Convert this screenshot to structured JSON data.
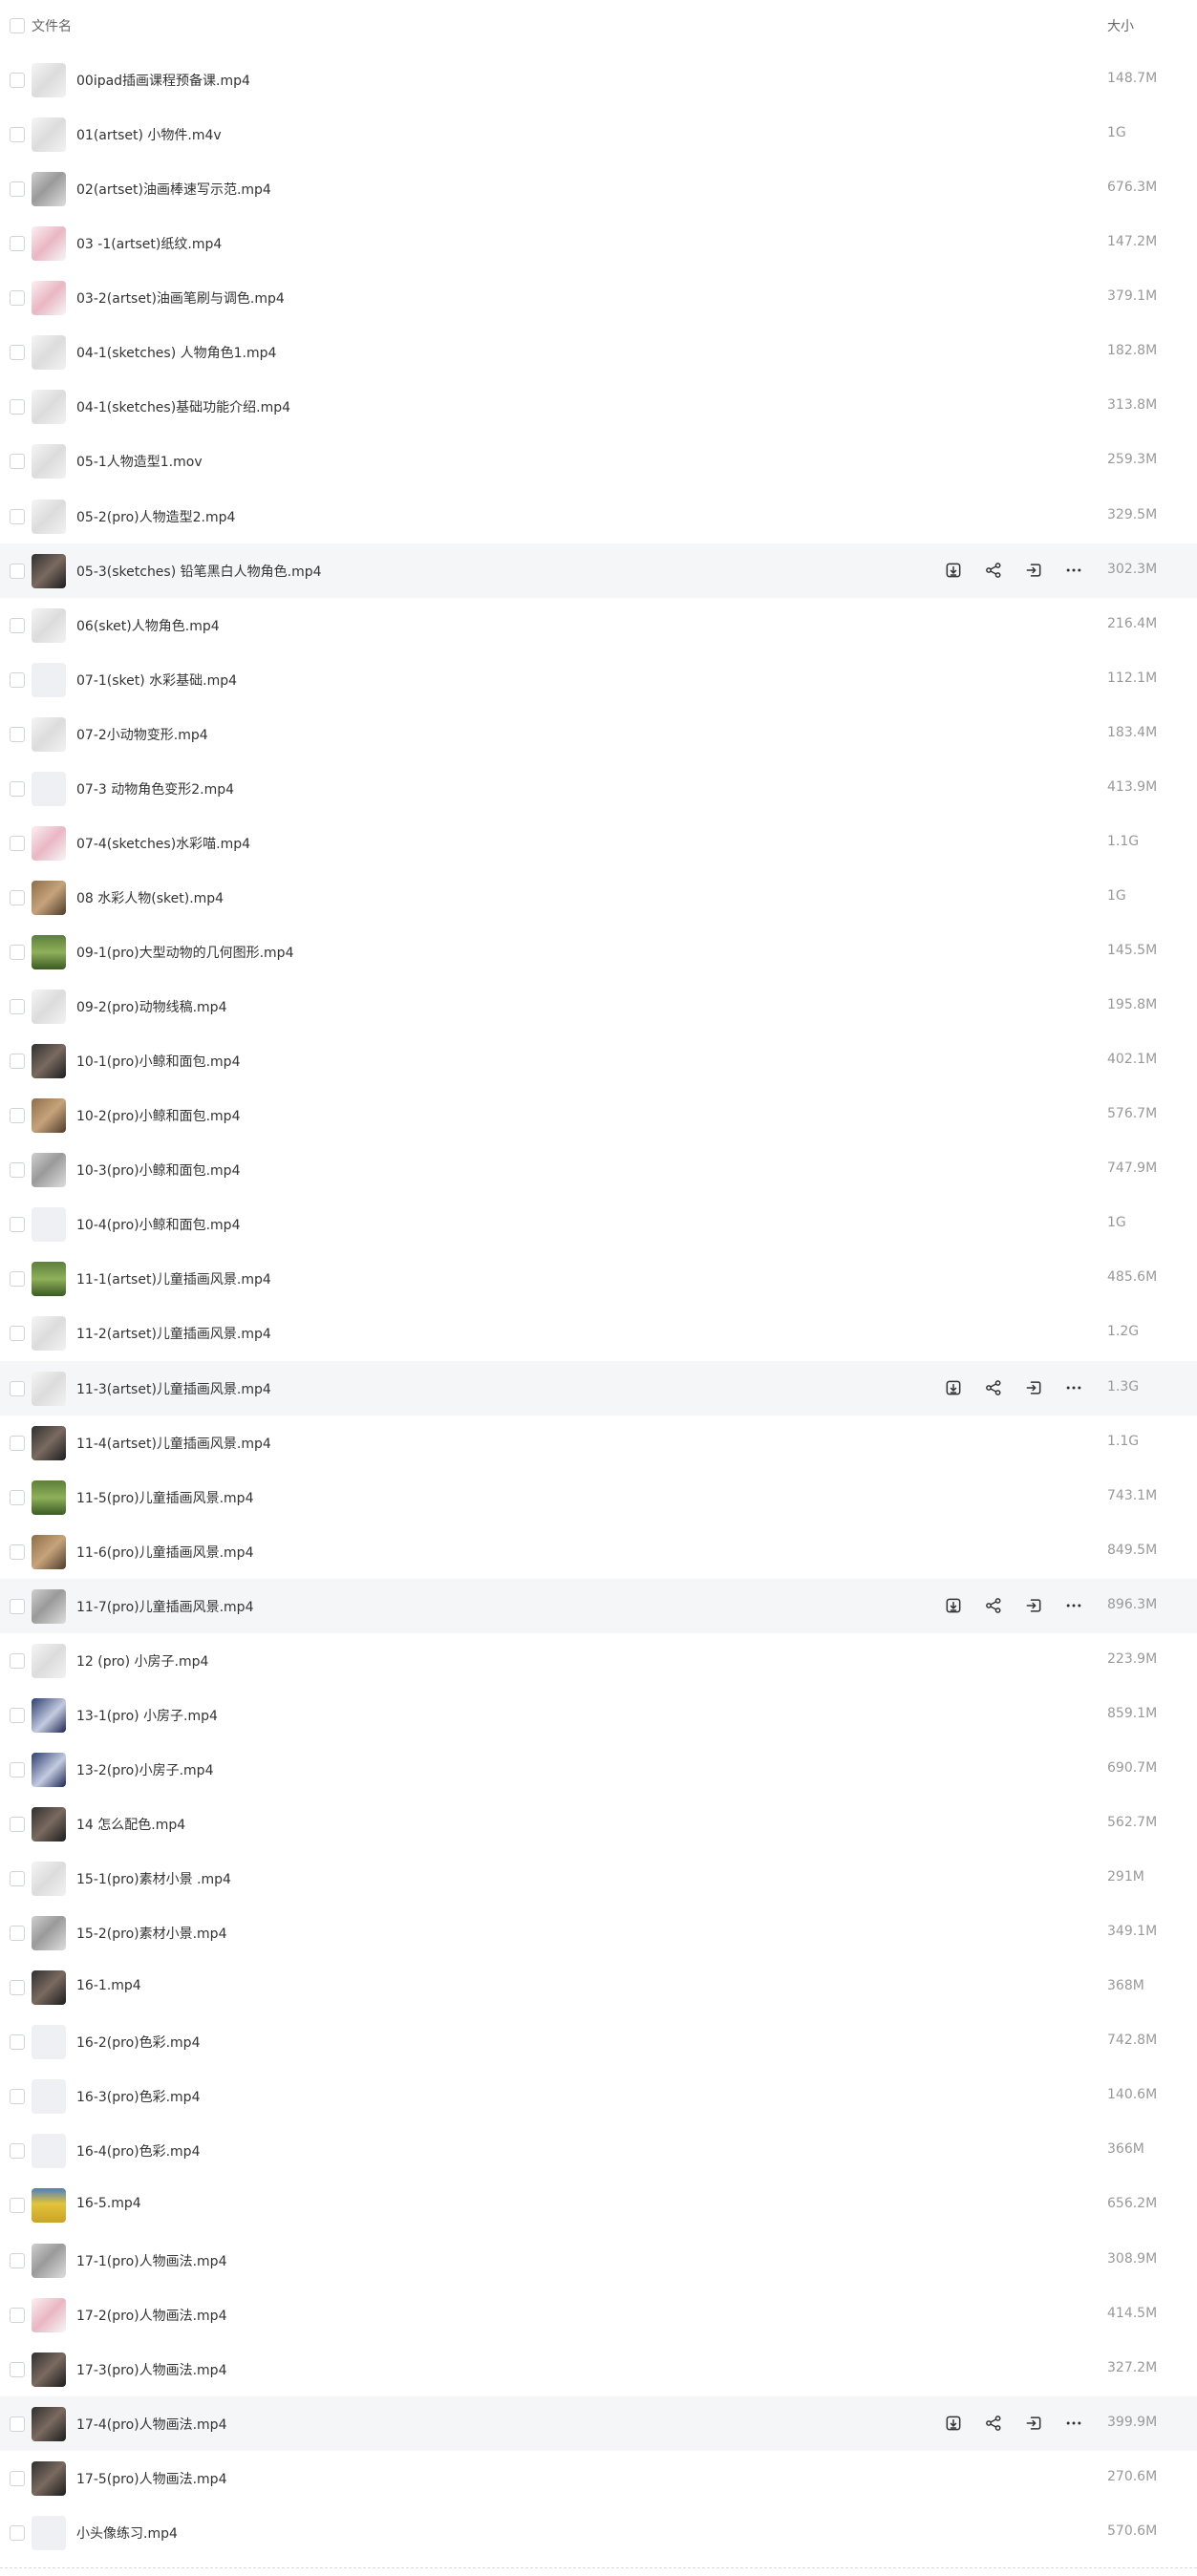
{
  "header": {
    "name_label": "文件名",
    "size_label": "大小"
  },
  "row_actions": {
    "download_icon": "download-icon",
    "share_icon": "share-icon",
    "move_icon": "move-icon",
    "more_icon": "more-icon"
  },
  "files": [
    {
      "name": "00ipad插画课程预备课.mp4",
      "size": "148.7M",
      "thumb": "t-light",
      "highlighted": false
    },
    {
      "name": "01(artset) 小物件.m4v",
      "size": "1G",
      "thumb": "t-light",
      "highlighted": false
    },
    {
      "name": "02(artset)油画棒速写示范.mp4",
      "size": "676.3M",
      "thumb": "t-mid",
      "highlighted": false
    },
    {
      "name": "03 -1(artset)纸纹.mp4",
      "size": "147.2M",
      "thumb": "t-pink",
      "highlighted": false
    },
    {
      "name": "03-2(artset)油画笔刷与调色.mp4",
      "size": "379.1M",
      "thumb": "t-pink",
      "highlighted": false
    },
    {
      "name": "04-1(sketches) 人物角色1.mp4",
      "size": "182.8M",
      "thumb": "t-light",
      "highlighted": false
    },
    {
      "name": "04-1(sketches)基础功能介绍.mp4",
      "size": "313.8M",
      "thumb": "t-light",
      "highlighted": false
    },
    {
      "name": "05-1人物造型1.mov",
      "size": "259.3M",
      "thumb": "t-light",
      "highlighted": false
    },
    {
      "name": "05-2(pro)人物造型2.mp4",
      "size": "329.5M",
      "thumb": "t-light",
      "highlighted": false
    },
    {
      "name": "05-3(sketches) 铅笔黑白人物角色.mp4",
      "size": "302.3M",
      "thumb": "t-dark",
      "highlighted": true
    },
    {
      "name": "06(sket)人物角色.mp4",
      "size": "216.4M",
      "thumb": "t-light",
      "highlighted": false
    },
    {
      "name": "07-1(sket) 水彩基础.mp4",
      "size": "112.1M",
      "thumb": "t-gray",
      "highlighted": false
    },
    {
      "name": "07-2小动物变形.mp4",
      "size": "183.4M",
      "thumb": "t-light",
      "highlighted": false
    },
    {
      "name": "07-3 动物角色变形2.mp4",
      "size": "413.9M",
      "thumb": "t-gray",
      "highlighted": false
    },
    {
      "name": "07-4(sketches)水彩喵.mp4",
      "size": "1.1G",
      "thumb": "t-pink",
      "highlighted": false
    },
    {
      "name": "08 水彩人物(sket).mp4",
      "size": "1G",
      "thumb": "t-brown",
      "highlighted": false
    },
    {
      "name": "09-1(pro)大型动物的几何图形.mp4",
      "size": "145.5M",
      "thumb": "t-green",
      "highlighted": false
    },
    {
      "name": "09-2(pro)动物线稿.mp4",
      "size": "195.8M",
      "thumb": "t-light",
      "highlighted": false
    },
    {
      "name": "10-1(pro)小鲸和面包.mp4",
      "size": "402.1M",
      "thumb": "t-dark",
      "highlighted": false
    },
    {
      "name": "10-2(pro)小鲸和面包.mp4",
      "size": "576.7M",
      "thumb": "t-brown",
      "highlighted": false
    },
    {
      "name": "10-3(pro)小鲸和面包.mp4",
      "size": "747.9M",
      "thumb": "t-mid",
      "highlighted": false
    },
    {
      "name": "10-4(pro)小鲸和面包.mp4",
      "size": "1G",
      "thumb": "t-gray",
      "highlighted": false
    },
    {
      "name": "11-1(artset)儿童插画风景.mp4",
      "size": "485.6M",
      "thumb": "t-green",
      "highlighted": false
    },
    {
      "name": "11-2(artset)儿童插画风景.mp4",
      "size": "1.2G",
      "thumb": "t-light",
      "highlighted": false
    },
    {
      "name": "11-3(artset)儿童插画风景.mp4",
      "size": "1.3G",
      "thumb": "t-light",
      "highlighted": true
    },
    {
      "name": "11-4(artset)儿童插画风景.mp4",
      "size": "1.1G",
      "thumb": "t-dark",
      "highlighted": false
    },
    {
      "name": "11-5(pro)儿童插画风景.mp4",
      "size": "743.1M",
      "thumb": "t-green",
      "highlighted": false
    },
    {
      "name": "11-6(pro)儿童插画风景.mp4",
      "size": "849.5M",
      "thumb": "t-brown",
      "highlighted": false
    },
    {
      "name": "11-7(pro)儿童插画风景.mp4",
      "size": "896.3M",
      "thumb": "t-mid",
      "highlighted": true
    },
    {
      "name": "12 (pro) 小房子.mp4",
      "size": "223.9M",
      "thumb": "t-light",
      "highlighted": false
    },
    {
      "name": "13-1(pro) 小房子.mp4",
      "size": "859.1M",
      "thumb": "t-blue",
      "highlighted": false
    },
    {
      "name": "13-2(pro)小房子.mp4",
      "size": "690.7M",
      "thumb": "t-blue",
      "highlighted": false
    },
    {
      "name": "14 怎么配色.mp4",
      "size": "562.7M",
      "thumb": "t-dark",
      "highlighted": false
    },
    {
      "name": "15-1(pro)素材小景 .mp4",
      "size": "291M",
      "thumb": "t-light",
      "highlighted": false
    },
    {
      "name": "15-2(pro)素材小景.mp4",
      "size": "349.1M",
      "thumb": "t-mid",
      "highlighted": false
    },
    {
      "name": "16-1.mp4",
      "size": "368M",
      "thumb": "t-dark",
      "highlighted": false
    },
    {
      "name": "16-2(pro)色彩.mp4",
      "size": "742.8M",
      "thumb": "t-gray",
      "highlighted": false
    },
    {
      "name": "16-3(pro)色彩.mp4",
      "size": "140.6M",
      "thumb": "t-gray",
      "highlighted": false
    },
    {
      "name": "16-4(pro)色彩.mp4",
      "size": "366M",
      "thumb": "t-gray",
      "highlighted": false
    },
    {
      "name": "16-5.mp4",
      "size": "656.2M",
      "thumb": "t-yellow",
      "highlighted": false
    },
    {
      "name": "17-1(pro)人物画法.mp4",
      "size": "308.9M",
      "thumb": "t-mid",
      "highlighted": false
    },
    {
      "name": "17-2(pro)人物画法.mp4",
      "size": "414.5M",
      "thumb": "t-pink",
      "highlighted": false
    },
    {
      "name": "17-3(pro)人物画法.mp4",
      "size": "327.2M",
      "thumb": "t-dark",
      "highlighted": false
    },
    {
      "name": "17-4(pro)人物画法.mp4",
      "size": "399.9M",
      "thumb": "t-dark",
      "highlighted": true
    },
    {
      "name": "17-5(pro)人物画法.mp4",
      "size": "270.6M",
      "thumb": "t-dark",
      "highlighted": false
    },
    {
      "name": "小头像练习.mp4",
      "size": "570.6M",
      "thumb": "t-gray",
      "highlighted": false
    }
  ]
}
